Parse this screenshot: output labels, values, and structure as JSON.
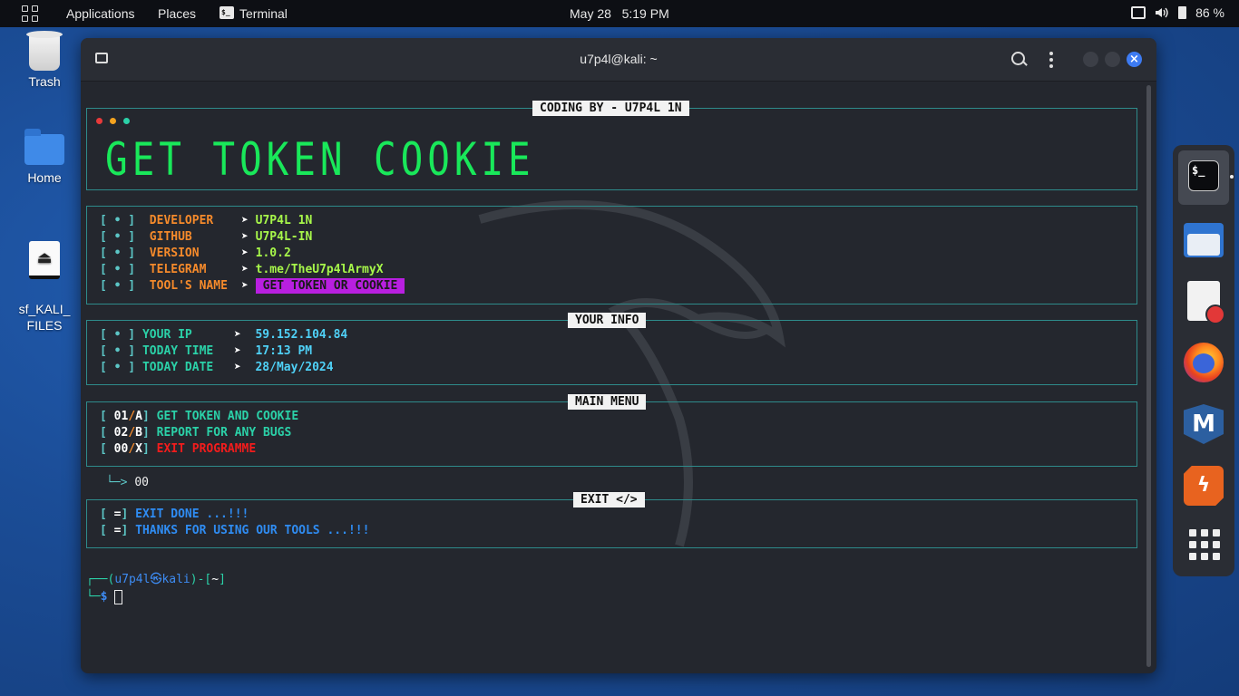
{
  "topbar": {
    "applications": "Applications",
    "places": "Places",
    "terminal": "Terminal",
    "date": "May 28",
    "time": "5:19 PM",
    "battery": "86 %"
  },
  "desktop": {
    "icons": [
      {
        "label": "Trash",
        "icon": "trash-icon"
      },
      {
        "label": "Home",
        "icon": "home-folder-icon"
      },
      {
        "label": "sf_KALI_\nFILES",
        "icon": "drive-icon"
      }
    ]
  },
  "window": {
    "title": "u7p4l@kali: ~"
  },
  "terminal": {
    "coding_by": "CODING BY - U7P4L 1N",
    "banner": "GET TOKEN COOKIE",
    "info_rows": [
      {
        "label": "DEVELOPER",
        "value": "U7P4L 1N"
      },
      {
        "label": "GITHUB",
        "value": "U7P4L-IN"
      },
      {
        "label": "VERSION",
        "value": "1.0.2"
      },
      {
        "label": "TELEGRAM",
        "value": "t.me/TheU7p4lArmyX"
      },
      {
        "label": "TOOL'S NAME",
        "value": "GET TOKEN OR COOKIE"
      }
    ],
    "your_info_title": "YOUR INFO",
    "your_info": [
      {
        "label": "YOUR IP",
        "value": "59.152.104.84"
      },
      {
        "label": "TODAY TIME",
        "value": "17:13 PM"
      },
      {
        "label": "TODAY DATE",
        "value": "28/May/2024"
      }
    ],
    "main_menu_title": "MAIN MENU",
    "menu": [
      {
        "num": "01",
        "key": "A",
        "label": "GET TOKEN AND COOKIE"
      },
      {
        "num": "02",
        "key": "B",
        "label": "REPORT FOR ANY BUGS"
      },
      {
        "num": "00",
        "key": "X",
        "label": "EXIT PROGRAMME"
      }
    ],
    "input_value": "00",
    "exit_title": "EXIT </>",
    "exit_lines": [
      "EXIT DONE ...!!!",
      "THANKS FOR USING OUR TOOLS ...!!!"
    ],
    "prompt_user": "u7p4l㉿kali",
    "prompt_dir": "~"
  },
  "colors": {
    "banner": "#19e85a",
    "label_orange": "#f58a2b",
    "value_green": "#a7f74a",
    "teal": "#2bd1a8",
    "cyan": "#4fd1f7",
    "red": "#f41c1c",
    "blue": "#2f8cf2",
    "magenta_highlight": "#b81fe0"
  },
  "dock": {
    "items": [
      "terminal-icon",
      "files-icon",
      "text-editor-icon",
      "firefox-icon",
      "metasploit-icon",
      "burpsuite-icon",
      "show-apps-icon"
    ]
  }
}
